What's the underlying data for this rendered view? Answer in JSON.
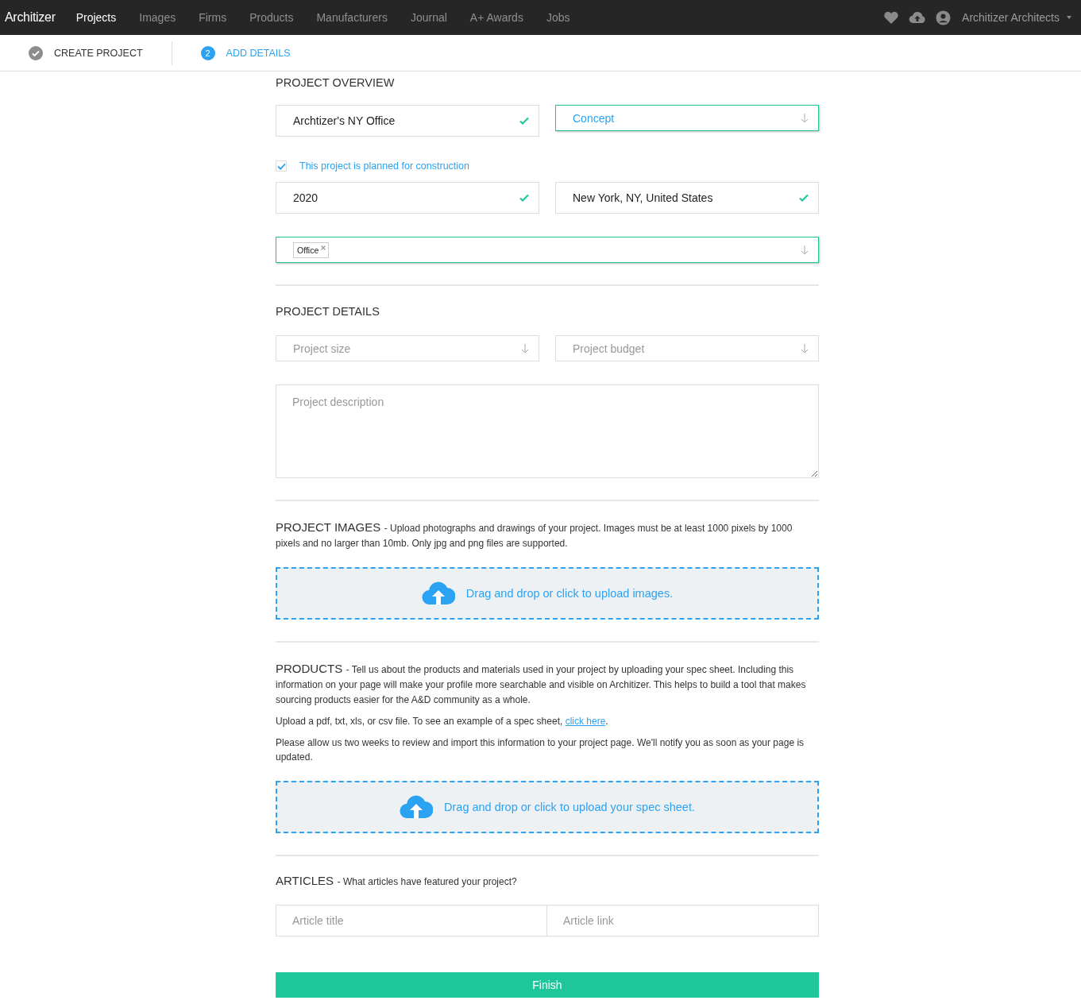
{
  "nav": {
    "logo": "Architizer",
    "items": [
      {
        "label": "Projects",
        "selected": true
      },
      {
        "label": "Images",
        "selected": false
      },
      {
        "label": "Firms",
        "selected": false
      },
      {
        "label": "Products",
        "selected": false
      },
      {
        "label": "Manufacturers",
        "selected": false
      },
      {
        "label": "Journal",
        "selected": false
      },
      {
        "label": "A+ Awards",
        "selected": false
      },
      {
        "label": "Jobs",
        "selected": false
      }
    ],
    "account": "Architizer Architects"
  },
  "steps": [
    {
      "label": "CREATE PROJECT",
      "completed": true,
      "selected": false
    },
    {
      "label": "ADD DETAILS",
      "number": "2",
      "completed": false,
      "selected": true
    }
  ],
  "overview": {
    "title": "PROJECT OVERVIEW",
    "name_field": {
      "value": "Archtizer's NY Office",
      "valid": true
    },
    "status_select": {
      "value": "Concept",
      "focused": true
    },
    "planned": {
      "label": "This project is planned for construction",
      "checked": true
    },
    "year_field": {
      "value": "2020",
      "valid": true
    },
    "location_field": {
      "value": "New York, NY, United States",
      "valid": true
    },
    "typology": {
      "tags": [
        "Office"
      ],
      "focused": true
    }
  },
  "details": {
    "title": "PROJECT DETAILS",
    "size_select": {
      "placeholder": "Project size"
    },
    "budget_select": {
      "placeholder": "Project budget"
    },
    "description": {
      "placeholder": "Project description"
    }
  },
  "images": {
    "title": "PROJECT IMAGES",
    "description": "- Upload photographs and drawings of your project. Images must be at least 1000 pixels by 1000 pixels and no larger than 10mb. Only jpg and png files are supported.",
    "dropzone": "Drag and drop or click to upload images."
  },
  "products": {
    "title": "PRODUCTS",
    "description": "- Tell us about the products and materials used in your project by uploading your spec sheet. Including this information on your page will make your profile more searchable and visible on Architizer. This helps to build a tool that makes sourcing products easier for the A&D community as a whole.",
    "note": {
      "before": "Upload a pdf, txt, xls, or csv file. To see an example of a spec sheet, ",
      "link": "click here",
      "after": "."
    },
    "notice": "Please allow us two weeks to review and import this information to your project page. We'll notify you as soon as your page is updated.",
    "dropzone": "Drag and drop or click to upload your spec sheet."
  },
  "articles": {
    "title": "ARTICLES",
    "description": "- What articles have featured your project?",
    "title_placeholder": "Article title",
    "link_placeholder": "Article link"
  },
  "finish": "Finish"
}
